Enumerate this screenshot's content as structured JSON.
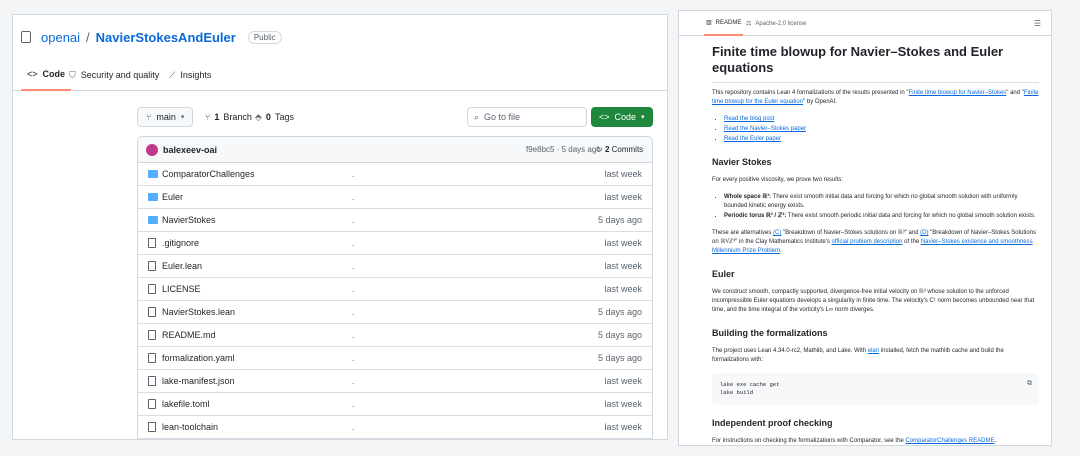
{
  "repo": {
    "owner": "openai",
    "name": "NavierStokesAndEuler",
    "visibility": "Public"
  },
  "tabs": [
    {
      "label": "Code",
      "icon": "code-icon"
    },
    {
      "label": "Security and quality",
      "icon": "shield-icon"
    },
    {
      "label": "Insights",
      "icon": "graph-icon"
    }
  ],
  "toolbar": {
    "branch": "main",
    "branches_count": "1",
    "branches_label": "Branch",
    "tags_count": "0",
    "tags_label": "Tags",
    "search_placeholder": "Go to file",
    "code_button": "Code"
  },
  "commit": {
    "author": "balexeev-oai",
    "dot": ".",
    "hash_time": "f9e8bc5 · 5 days ago",
    "count_num": "2",
    "count_label": "Commits"
  },
  "files": [
    {
      "name": "ComparatorChallenges",
      "type": "folder",
      "message": ".",
      "date": "last week"
    },
    {
      "name": "Euler",
      "type": "folder",
      "message": ".",
      "date": "last week"
    },
    {
      "name": "NavierStokes",
      "type": "folder",
      "message": ".",
      "date": "5 days ago"
    },
    {
      "name": ".gitignore",
      "type": "file",
      "message": ".",
      "date": "last week"
    },
    {
      "name": "Euler.lean",
      "type": "file",
      "message": ".",
      "date": "last week"
    },
    {
      "name": "LICENSE",
      "type": "file",
      "message": ".",
      "date": "last week"
    },
    {
      "name": "NavierStokes.lean",
      "type": "file",
      "message": ".",
      "date": "5 days ago"
    },
    {
      "name": "README.md",
      "type": "file",
      "message": ".",
      "date": "5 days ago"
    },
    {
      "name": "formalization.yaml",
      "type": "file",
      "message": ".",
      "date": "5 days ago"
    },
    {
      "name": "lake-manifest.json",
      "type": "file",
      "message": ".",
      "date": "last week"
    },
    {
      "name": "lakefile.toml",
      "type": "file",
      "message": ".",
      "date": "last week"
    },
    {
      "name": "lean-toolchain",
      "type": "file",
      "message": ".",
      "date": "last week"
    }
  ],
  "readme_tabs": [
    {
      "label": "README",
      "icon": "book-icon"
    },
    {
      "label": "Apache-2.0 license",
      "icon": "scale-icon"
    }
  ],
  "readme": {
    "title": "Finite time blowup for Navier–Stokes and Euler equations",
    "intro_1": "This repository contains Lean 4 formalizations of the results presented in \"",
    "intro_link_1": "Finite time blowup for Navier–Stokes",
    "intro_2": "\" and \"",
    "intro_link_2": "Finite time blowup for the Euler equation",
    "intro_3": "\" by OpenAI.",
    "links": [
      "Read the blog post",
      "Read the Navier–Stokes paper",
      "Read the Euler paper"
    ],
    "ns_heading": "Navier Stokes",
    "ns_p1": "For every positive viscosity, we prove two results:",
    "ns_b1_label": "Whole space ℝ³:",
    "ns_b1_text": " There exist smooth initial data and forcing for which no global smooth solution with uniformly bounded kinetic energy exists.",
    "ns_b2_label": "Periodic torus ℝ³ / ℤ³:",
    "ns_b2_text": " There exist smooth periodic initial data and forcing for which no global smooth solution exists.",
    "ns_p2_1": "These are alternatives ",
    "ns_p2_c": "(C)",
    "ns_p2_2": " \"Breakdown of Navier–Stokes solutions on ℝ³\" and ",
    "ns_p2_d": "(D)",
    "ns_p2_3": " \"Breakdown of Navier–Stokes Solutions on ℝ³/ℤ³\" in the Clay Mathematics Institute's ",
    "ns_p2_link1": "official problem description",
    "ns_p2_4": " of the ",
    "ns_p2_link2": "Navier–Stokes existence and smoothness Millennium Prize Problem",
    "ns_p2_5": ".",
    "euler_heading": "Euler",
    "euler_p": "We construct smooth, compactly supported, divergence-free initial velocity on ℝ³ whose solution to the unforced incompressible Euler equations develops a singularity in finite time. The velocity's C¹ norm becomes unbounded near that time, and the time integral of the vorticity's L∞ norm diverges.",
    "build_heading": "Building the formalizations",
    "build_p_1": "The project uses Lean 4.34.0-rc2, Mathlib, and Lake. With ",
    "build_p_link": "elan",
    "build_p_2": " installed, fetch the mathlib cache and build the formalizations with:",
    "code_line1": "lake exe cache get",
    "code_line2": "lake build",
    "proof_heading": "Independent proof checking",
    "proof_p_1": "For instructions on checking the formalizations with Comparator, see the ",
    "proof_p_link": "ComparatorChallenges README",
    "proof_p_2": "."
  }
}
